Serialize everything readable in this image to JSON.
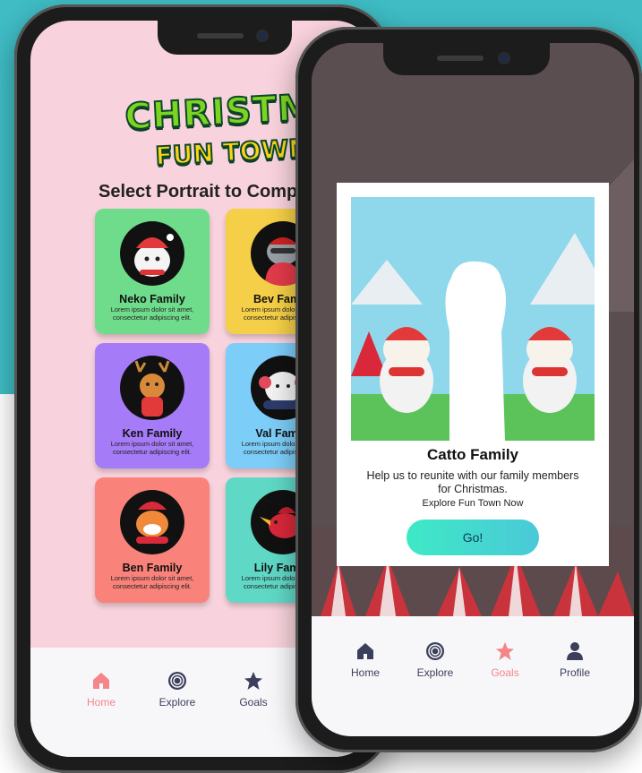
{
  "left_phone": {
    "logo_line1": "CHRISTMAS",
    "logo_line2": "FUN TOWN!",
    "title": "Select Portrait to Complete",
    "cards": [
      {
        "name": "Neko Family",
        "desc": "Lorem ipsum dolor sit amet, consectetur adipiscing elit.",
        "color": "#6fdc8c"
      },
      {
        "name": "Bev Family",
        "desc": "Lorem ipsum dolor sit amet, consectetur adipiscing elit.",
        "color": "#f5cf47"
      },
      {
        "name": "Ken Family",
        "desc": "Lorem ipsum dolor sit amet, consectetur adipiscing elit.",
        "color": "#a57bf7"
      },
      {
        "name": "Val Family",
        "desc": "Lorem ipsum dolor sit amet, consectetur adipiscing elit.",
        "color": "#7ccdf8"
      },
      {
        "name": "Ben Family",
        "desc": "Lorem ipsum dolor sit amet, consectetur adipiscing elit.",
        "color": "#f9827a"
      },
      {
        "name": "Lily Family",
        "desc": "Lorem ipsum dolor sit amet, consectetur adipiscing elit.",
        "color": "#5fd8c6"
      }
    ],
    "tabs": [
      {
        "label": "Home",
        "icon": "home-icon",
        "active": true
      },
      {
        "label": "Explore",
        "icon": "explore-icon",
        "active": false
      },
      {
        "label": "Goals",
        "icon": "star-icon",
        "active": false
      }
    ]
  },
  "right_phone": {
    "modal": {
      "title": "Catto Family",
      "body": "Help us to reunite with our family members for Christmas.",
      "sub": "Explore Fun Town Now",
      "button": "Go!"
    },
    "tabs": [
      {
        "label": "Home",
        "icon": "home-icon",
        "active": false
      },
      {
        "label": "Explore",
        "icon": "explore-icon",
        "active": false
      },
      {
        "label": "Goals",
        "icon": "star-icon",
        "active": true
      },
      {
        "label": "Profile",
        "icon": "profile-icon",
        "active": false
      }
    ]
  },
  "colors": {
    "active_tab": "#f4868a",
    "inactive_tab": "#3b3f5c",
    "button_start": "#3ee9c5",
    "button_end": "#4ac9d8"
  }
}
